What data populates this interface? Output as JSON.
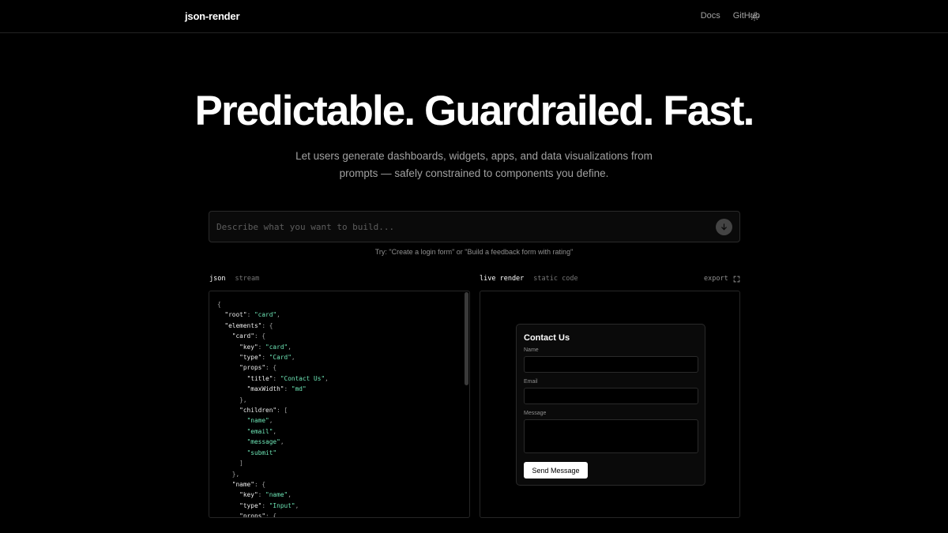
{
  "nav": {
    "brand": "json-render",
    "links": [
      "Docs",
      "GitHub"
    ],
    "theme_icon": "sun-icon"
  },
  "hero": {
    "title": "Predictable. Guardrailed. Fast.",
    "subtitle_line1": "Let users generate dashboards, widgets, apps, and data visualizations from",
    "subtitle_line2": "prompts — safely constrained to components you define."
  },
  "prompt": {
    "placeholder": "Describe what you want to build...",
    "value": "",
    "submit_icon": "arrow-down-icon",
    "hint": "Try: \"Create a login form\" or \"Build a feedback form with rating\""
  },
  "left_tabs": {
    "active": "json",
    "inactive": "stream"
  },
  "right_tabs": {
    "active": "live render",
    "inactive": "static code",
    "export_label": "export",
    "fullscreen_icon": "fullscreen-icon"
  },
  "json_lines": [
    [
      [
        "p",
        "{"
      ]
    ],
    [
      [
        "p",
        "  "
      ],
      [
        "k",
        "\"root\""
      ],
      [
        "p",
        ": "
      ],
      [
        "s",
        "\"card\""
      ],
      [
        "p",
        ","
      ]
    ],
    [
      [
        "p",
        "  "
      ],
      [
        "k",
        "\"elements\""
      ],
      [
        "p",
        ": {"
      ]
    ],
    [
      [
        "p",
        "    "
      ],
      [
        "k",
        "\"card\""
      ],
      [
        "p",
        ": {"
      ]
    ],
    [
      [
        "p",
        "      "
      ],
      [
        "k",
        "\"key\""
      ],
      [
        "p",
        ": "
      ],
      [
        "s",
        "\"card\""
      ],
      [
        "p",
        ","
      ]
    ],
    [
      [
        "p",
        "      "
      ],
      [
        "k",
        "\"type\""
      ],
      [
        "p",
        ": "
      ],
      [
        "s",
        "\"Card\""
      ],
      [
        "p",
        ","
      ]
    ],
    [
      [
        "p",
        "      "
      ],
      [
        "k",
        "\"props\""
      ],
      [
        "p",
        ": {"
      ]
    ],
    [
      [
        "p",
        "        "
      ],
      [
        "k",
        "\"title\""
      ],
      [
        "p",
        ": "
      ],
      [
        "s",
        "\"Contact Us\""
      ],
      [
        "p",
        ","
      ]
    ],
    [
      [
        "p",
        "        "
      ],
      [
        "k",
        "\"maxWidth\""
      ],
      [
        "p",
        ": "
      ],
      [
        "s",
        "\"md\""
      ]
    ],
    [
      [
        "p",
        "      },"
      ]
    ],
    [
      [
        "p",
        "      "
      ],
      [
        "k",
        "\"children\""
      ],
      [
        "p",
        ": ["
      ]
    ],
    [
      [
        "p",
        "        "
      ],
      [
        "s",
        "\"name\""
      ],
      [
        "p",
        ","
      ]
    ],
    [
      [
        "p",
        "        "
      ],
      [
        "s",
        "\"email\""
      ],
      [
        "p",
        ","
      ]
    ],
    [
      [
        "p",
        "        "
      ],
      [
        "s",
        "\"message\""
      ],
      [
        "p",
        ","
      ]
    ],
    [
      [
        "p",
        "        "
      ],
      [
        "s",
        "\"submit\""
      ]
    ],
    [
      [
        "p",
        "      ]"
      ]
    ],
    [
      [
        "p",
        "    },"
      ]
    ],
    [
      [
        "p",
        "    "
      ],
      [
        "k",
        "\"name\""
      ],
      [
        "p",
        ": {"
      ]
    ],
    [
      [
        "p",
        "      "
      ],
      [
        "k",
        "\"key\""
      ],
      [
        "p",
        ": "
      ],
      [
        "s",
        "\"name\""
      ],
      [
        "p",
        ","
      ]
    ],
    [
      [
        "p",
        "      "
      ],
      [
        "k",
        "\"type\""
      ],
      [
        "p",
        ": "
      ],
      [
        "s",
        "\"Input\""
      ],
      [
        "p",
        ","
      ]
    ],
    [
      [
        "p",
        "      "
      ],
      [
        "k",
        "\"props\""
      ],
      [
        "p",
        ": {"
      ]
    ]
  ],
  "form": {
    "title": "Contact Us",
    "name_label": "Name",
    "email_label": "Email",
    "message_label": "Message",
    "name_value": "",
    "email_value": "",
    "message_value": "",
    "submit_label": "Send Message"
  },
  "colors": {
    "background": "#000000",
    "json_string": "#6ee7b7",
    "submit_button_bg": "#444444"
  }
}
